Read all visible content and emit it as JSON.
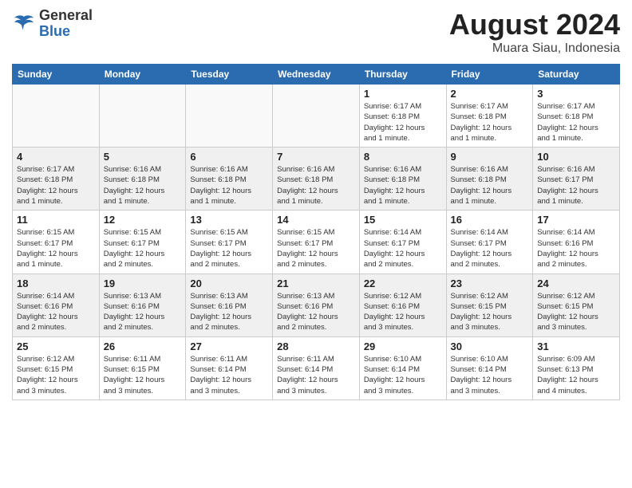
{
  "header": {
    "logo_general": "General",
    "logo_blue": "Blue",
    "month": "August 2024",
    "location": "Muara Siau, Indonesia"
  },
  "weekdays": [
    "Sunday",
    "Monday",
    "Tuesday",
    "Wednesday",
    "Thursday",
    "Friday",
    "Saturday"
  ],
  "weeks": [
    [
      {
        "day": "",
        "info": ""
      },
      {
        "day": "",
        "info": ""
      },
      {
        "day": "",
        "info": ""
      },
      {
        "day": "",
        "info": ""
      },
      {
        "day": "1",
        "info": "Sunrise: 6:17 AM\nSunset: 6:18 PM\nDaylight: 12 hours\nand 1 minute."
      },
      {
        "day": "2",
        "info": "Sunrise: 6:17 AM\nSunset: 6:18 PM\nDaylight: 12 hours\nand 1 minute."
      },
      {
        "day": "3",
        "info": "Sunrise: 6:17 AM\nSunset: 6:18 PM\nDaylight: 12 hours\nand 1 minute."
      }
    ],
    [
      {
        "day": "4",
        "info": "Sunrise: 6:17 AM\nSunset: 6:18 PM\nDaylight: 12 hours\nand 1 minute."
      },
      {
        "day": "5",
        "info": "Sunrise: 6:16 AM\nSunset: 6:18 PM\nDaylight: 12 hours\nand 1 minute."
      },
      {
        "day": "6",
        "info": "Sunrise: 6:16 AM\nSunset: 6:18 PM\nDaylight: 12 hours\nand 1 minute."
      },
      {
        "day": "7",
        "info": "Sunrise: 6:16 AM\nSunset: 6:18 PM\nDaylight: 12 hours\nand 1 minute."
      },
      {
        "day": "8",
        "info": "Sunrise: 6:16 AM\nSunset: 6:18 PM\nDaylight: 12 hours\nand 1 minute."
      },
      {
        "day": "9",
        "info": "Sunrise: 6:16 AM\nSunset: 6:18 PM\nDaylight: 12 hours\nand 1 minute."
      },
      {
        "day": "10",
        "info": "Sunrise: 6:16 AM\nSunset: 6:17 PM\nDaylight: 12 hours\nand 1 minute."
      }
    ],
    [
      {
        "day": "11",
        "info": "Sunrise: 6:15 AM\nSunset: 6:17 PM\nDaylight: 12 hours\nand 1 minute."
      },
      {
        "day": "12",
        "info": "Sunrise: 6:15 AM\nSunset: 6:17 PM\nDaylight: 12 hours\nand 2 minutes."
      },
      {
        "day": "13",
        "info": "Sunrise: 6:15 AM\nSunset: 6:17 PM\nDaylight: 12 hours\nand 2 minutes."
      },
      {
        "day": "14",
        "info": "Sunrise: 6:15 AM\nSunset: 6:17 PM\nDaylight: 12 hours\nand 2 minutes."
      },
      {
        "day": "15",
        "info": "Sunrise: 6:14 AM\nSunset: 6:17 PM\nDaylight: 12 hours\nand 2 minutes."
      },
      {
        "day": "16",
        "info": "Sunrise: 6:14 AM\nSunset: 6:17 PM\nDaylight: 12 hours\nand 2 minutes."
      },
      {
        "day": "17",
        "info": "Sunrise: 6:14 AM\nSunset: 6:16 PM\nDaylight: 12 hours\nand 2 minutes."
      }
    ],
    [
      {
        "day": "18",
        "info": "Sunrise: 6:14 AM\nSunset: 6:16 PM\nDaylight: 12 hours\nand 2 minutes."
      },
      {
        "day": "19",
        "info": "Sunrise: 6:13 AM\nSunset: 6:16 PM\nDaylight: 12 hours\nand 2 minutes."
      },
      {
        "day": "20",
        "info": "Sunrise: 6:13 AM\nSunset: 6:16 PM\nDaylight: 12 hours\nand 2 minutes."
      },
      {
        "day": "21",
        "info": "Sunrise: 6:13 AM\nSunset: 6:16 PM\nDaylight: 12 hours\nand 2 minutes."
      },
      {
        "day": "22",
        "info": "Sunrise: 6:12 AM\nSunset: 6:16 PM\nDaylight: 12 hours\nand 3 minutes."
      },
      {
        "day": "23",
        "info": "Sunrise: 6:12 AM\nSunset: 6:15 PM\nDaylight: 12 hours\nand 3 minutes."
      },
      {
        "day": "24",
        "info": "Sunrise: 6:12 AM\nSunset: 6:15 PM\nDaylight: 12 hours\nand 3 minutes."
      }
    ],
    [
      {
        "day": "25",
        "info": "Sunrise: 6:12 AM\nSunset: 6:15 PM\nDaylight: 12 hours\nand 3 minutes."
      },
      {
        "day": "26",
        "info": "Sunrise: 6:11 AM\nSunset: 6:15 PM\nDaylight: 12 hours\nand 3 minutes."
      },
      {
        "day": "27",
        "info": "Sunrise: 6:11 AM\nSunset: 6:14 PM\nDaylight: 12 hours\nand 3 minutes."
      },
      {
        "day": "28",
        "info": "Sunrise: 6:11 AM\nSunset: 6:14 PM\nDaylight: 12 hours\nand 3 minutes."
      },
      {
        "day": "29",
        "info": "Sunrise: 6:10 AM\nSunset: 6:14 PM\nDaylight: 12 hours\nand 3 minutes."
      },
      {
        "day": "30",
        "info": "Sunrise: 6:10 AM\nSunset: 6:14 PM\nDaylight: 12 hours\nand 3 minutes."
      },
      {
        "day": "31",
        "info": "Sunrise: 6:09 AM\nSunset: 6:13 PM\nDaylight: 12 hours\nand 4 minutes."
      }
    ]
  ]
}
